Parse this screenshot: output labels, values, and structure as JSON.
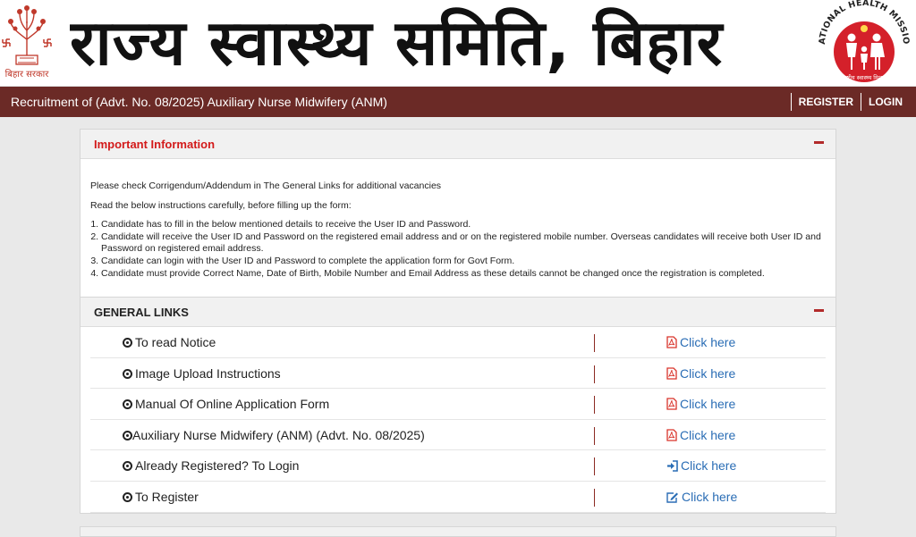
{
  "header": {
    "banner_title": "राज्य स्वास्थ्य समिति, बिहार",
    "left_emblem_caption": "बिहार सरकार",
    "nhm_ring_text": "NATIONAL HEALTH MISSION",
    "nhm_caption": "राष्ट्रीय स्वास्थ्य मिशन"
  },
  "topbar": {
    "title": "Recruitment of (Advt. No. 08/2025) Auxiliary Nurse Midwifery (ANM)",
    "register": "REGISTER",
    "login": "LOGIN"
  },
  "important": {
    "title": "Important Information",
    "line1": "Please check Corrigendum/Addendum in The General Links for additional vacancies",
    "line2": "Read the below instructions carefully, before filling up the form:",
    "items": [
      "Candidate has to fill in the below mentioned details to receive the User ID and Password.",
      "Candidate will receive the User ID and Password on the registered email address and or on the registered mobile number. Overseas candidates will receive both User ID and Password on registered email address.",
      "Candidate can login with the User ID and Password to complete the application form for Govt Form.",
      "Candidate must provide Correct Name, Date of Birth, Mobile Number and Email Address as these details cannot be changed once the registration is completed."
    ]
  },
  "general_links": {
    "title": "GENERAL LINKS",
    "rows": [
      {
        "label": "To read Notice",
        "action": "Click here",
        "icon": "pdf-icon"
      },
      {
        "label": "Image Upload Instructions",
        "action": "Click here",
        "icon": "pdf-icon"
      },
      {
        "label": "Manual Of Online Application Form",
        "action": "Click here",
        "icon": "pdf-icon"
      },
      {
        "label": "Auxiliary Nurse Midwifery (ANM) (Advt. No. 08/2025)",
        "action": "Click here",
        "icon": "pdf-icon"
      },
      {
        "label": "Already Registered? To Login",
        "action": "Click here",
        "icon": "sign-in-icon"
      },
      {
        "label": "To Register",
        "action": "Click here",
        "icon": "edit-icon"
      }
    ]
  },
  "colors": {
    "topbar": "#6b2a26",
    "important_title": "#d31a1a",
    "link": "#2a6db5",
    "pdf_icon": "#d9342b",
    "nhm_red": "#d4202a"
  }
}
